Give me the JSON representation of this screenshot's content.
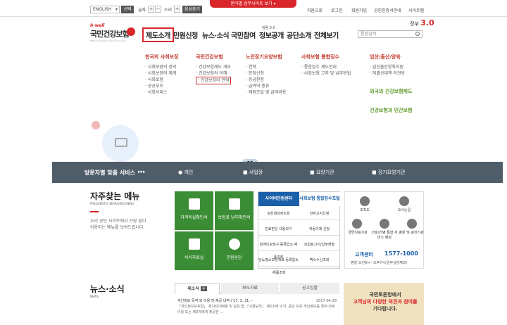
{
  "topbar": {
    "lang": "ENGLISH",
    "select": "선택",
    "font": "글자",
    "sound": "소리",
    "voice_btn": "음성듣기",
    "red_tab": "분야별 업무사이트 보기",
    "links": [
      "처음으로",
      "로그인",
      "회원가입",
      "공인인증서안내",
      "사이트맵"
    ]
  },
  "logo": {
    "en": "h-well",
    "ko": "국민건강보험",
    "sub": "National Health Insurance Service"
  },
  "nav": [
    "제도소개",
    "민원신청",
    "뉴스·소식",
    "국민참여",
    "정보공개",
    "공단소개",
    "전체보기"
  ],
  "nav_sup": "청렴 3.0",
  "gov": {
    "a": "정부",
    "b": "3.0"
  },
  "search": {
    "placeholder": "통합검색"
  },
  "mega": [
    {
      "title": "한국의 사회보장",
      "items": [
        "사회보장의 정의",
        "사회보장의 체계",
        "사회보험",
        "공공부조",
        "사회서비스"
      ]
    },
    {
      "title": "국민건강보험",
      "items": [
        "건강보험제도 개요",
        "건강보험의 이해",
        "건강보험의 연혁"
      ]
    },
    {
      "title": "노인장기요양보험",
      "items": [
        "연혁",
        "인정신청",
        "등급판정",
        "급여의 종류",
        "재원조달 및 급여비용"
      ]
    },
    {
      "title": "사회보험 통합징수",
      "items": [
        "통합징수 제도안내",
        "사회보험 고지 및 납부방법"
      ]
    },
    {
      "title": "임산/출산/양육",
      "items": [
        "임신출산양육지원",
        "저출산대책 의견방"
      ]
    }
  ],
  "green_links": [
    "외국의 건강보험제도",
    "건강보험과 민간보험"
  ],
  "bluebar": {
    "title": "방문자별 맞춤 서비스",
    "items": [
      "개인",
      "사업장",
      "요양기관",
      "장기요양기관"
    ]
  },
  "fav": {
    "title": "자주찾는 메뉴",
    "sub": "FREQUENTLY SEARCHED MENU",
    "desc": [
      "우리 공단 사이트에서 가장 많이",
      "이용되는 메뉴를 보여드립니다."
    ]
  },
  "tiles": [
    "자격득실확인서",
    "보험료 납부확인서",
    "서식자료실",
    "민원상담"
  ],
  "svc": {
    "h1": "사이버민원센터",
    "h2": "사회보험 통합징수포털",
    "cells": [
      "검진대상자조회",
      "전자고지신청",
      "진료받은 내용보기",
      "자동이체 신청",
      "장애인보장구 등록업소·제품조회",
      "보험료고지/납부현황",
      "당뇨병소모성재료 등록업소·제품조회",
      "팩스수신조회"
    ]
  },
  "cs": {
    "items": [
      "조직도",
      "오시는길",
      "금연치료기관",
      "간호/간병 통합 서비스 병원",
      "병원 및 검진기관"
    ],
    "phone_label": "고객센터",
    "phone": "1577-1000",
    "hours": "평일 오전9시~오후7시(일부상담제외)"
  },
  "news": {
    "title": "뉴스·소식",
    "sub": "NEWS",
    "tabs": [
      "새소식",
      "보도자료",
      "공고입찰"
    ],
    "item_title": "개인정보 목적 외 이용 및 제공 내역 (‘17. 3. 31. –",
    "date": "2017-04-28",
    "body": "「개인정보보호법」 제18조제4항 및 같은 법 「시행규칙」 제2조에 의거, 공단 보유 개인정보를 목적 외로 이용 또는 제3자에게 제공한 ..."
  },
  "banner": {
    "line1": "국민토론방에서",
    "line2": "고객님의 다양한 의견과 참여를",
    "line3": "기다립니다."
  }
}
